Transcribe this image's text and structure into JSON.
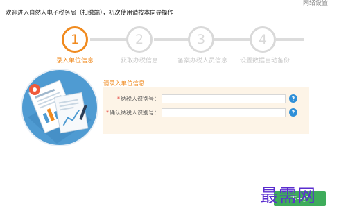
{
  "header": {
    "welcome_text": "欢迎进入自然人电子税务局（扣缴端），初次使用请按本向导操作",
    "top_right_link": "网络设置"
  },
  "steps": [
    {
      "number": "1",
      "label": "录入单位信息",
      "active": true
    },
    {
      "number": "2",
      "label": "获取办税信息",
      "active": false
    },
    {
      "number": "3",
      "label": "备案办税人员信息",
      "active": false
    },
    {
      "number": "4",
      "label": "设置数据自动备份",
      "active": false
    }
  ],
  "form": {
    "section_title": "请录入单位信息",
    "fields": [
      {
        "label": "纳税人识别号：",
        "required": true,
        "value": ""
      },
      {
        "label": "确认纳税人识别号：",
        "required": true,
        "value": ""
      }
    ],
    "help_symbol": "?"
  },
  "footer": {
    "next_button_label": "下一步",
    "watermark": "最需网"
  },
  "colors": {
    "accent": "#f08a1e",
    "inactive": "#d9d9d9",
    "panel_bg": "#fdf4e7",
    "help_blue": "#2e8fd8",
    "button_green": "#34a853",
    "illustration_circle": "#4f9bd2"
  },
  "icons": {
    "illustration": "document-report-illustration",
    "help": "help-icon"
  }
}
